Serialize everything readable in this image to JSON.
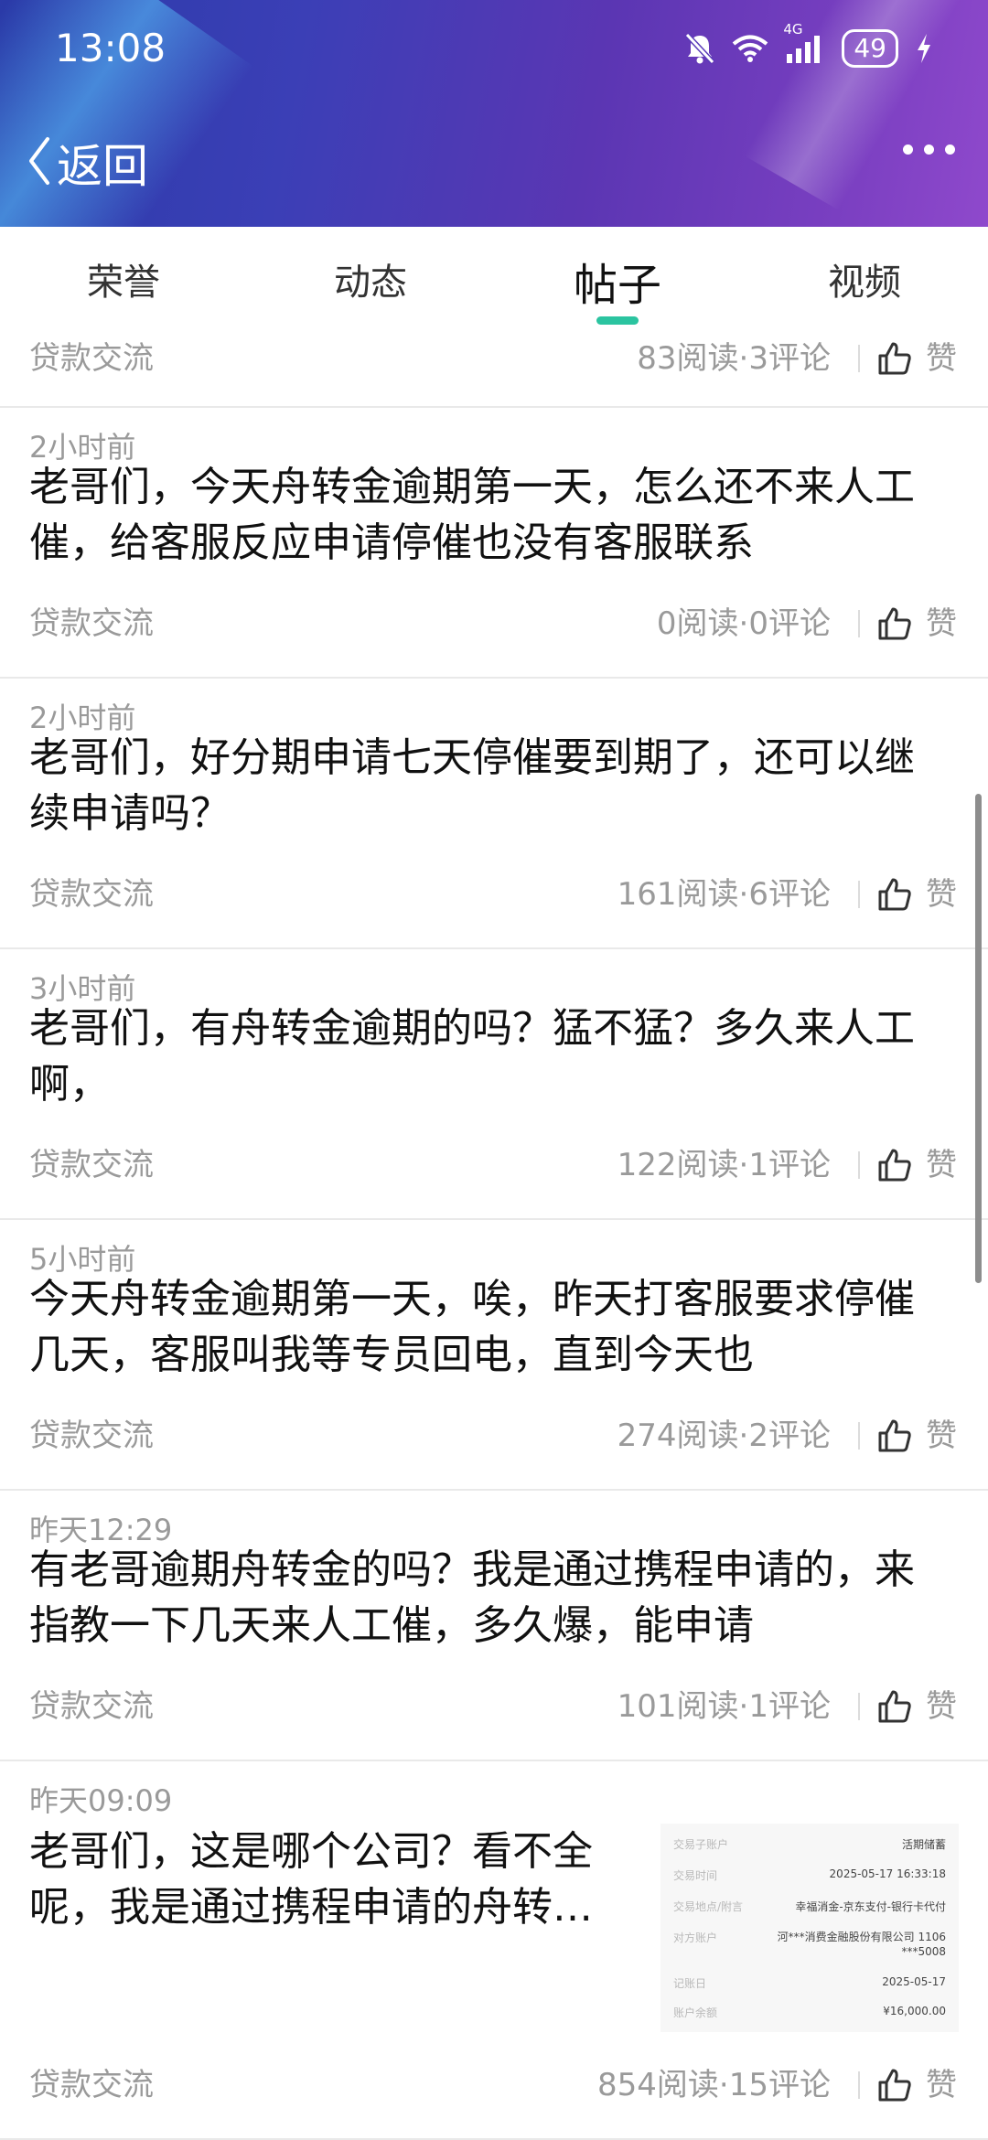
{
  "status_bar": {
    "time": "13:08",
    "network": "4G",
    "battery": "49",
    "icons": [
      "bell-muted-icon",
      "wifi-icon",
      "signal-icon",
      "battery-icon",
      "charging-icon"
    ]
  },
  "header": {
    "back_label": "返回",
    "more_icon": "more-dots-icon"
  },
  "tabs": [
    {
      "label": "荣誉",
      "active": false
    },
    {
      "label": "动态",
      "active": false
    },
    {
      "label": "帖子",
      "active": true
    },
    {
      "label": "视频",
      "active": false
    }
  ],
  "top_partial": {
    "category": "贷款交流",
    "stats": "83阅读·3评论",
    "like_label": "赞"
  },
  "posts": [
    {
      "time": "2小时前",
      "title": "老哥们，今天舟转金逾期第一天，怎么还不来人工催，给客服反应申请停催也没有客服联系",
      "category": "贷款交流",
      "stats": "0阅读·0评论",
      "like_label": "赞"
    },
    {
      "time": "2小时前",
      "title": "老哥们，好分期申请七天停催要到期了，还可以继续申请吗？",
      "category": "贷款交流",
      "stats": "161阅读·6评论",
      "like_label": "赞"
    },
    {
      "time": "3小时前",
      "title": "老哥们，有舟转金逾期的吗？猛不猛？多久来人工啊，",
      "category": "贷款交流",
      "stats": "122阅读·1评论",
      "like_label": "赞"
    },
    {
      "time": "5小时前",
      "title": "今天舟转金逾期第一天，唉，昨天打客服要求停催几天，客服叫我等专员回电，直到今天也",
      "category": "贷款交流",
      "stats": "274阅读·2评论",
      "like_label": "赞"
    },
    {
      "time": "昨天12:29",
      "title": "有老哥逾期舟转金的吗？我是通过携程申请的，来指教一下几天来人工催，多久爆，能申请",
      "category": "贷款交流",
      "stats": "101阅读·1评论",
      "like_label": "赞"
    },
    {
      "time": "昨天09:09",
      "title": "老哥们，这是哪个公司？看不全呢，我是通过携程申请的舟转…",
      "category": "贷款交流",
      "stats": "854阅读·15评论",
      "like_label": "赞",
      "thumbnail": {
        "rows": [
          {
            "k": "交易子账户",
            "v": "活期储蓄"
          },
          {
            "k": "交易时间",
            "v": "2025-05-17 16:33:18"
          },
          {
            "k": "交易地点/附言",
            "v": "幸福消金-京东支付-银行卡代付"
          },
          {
            "k": "对方账户",
            "v": "河***消费金融股份有限公司 1106***5008"
          },
          {
            "k": "记账日",
            "v": "2025-05-17"
          },
          {
            "k": "账户余额",
            "v": "¥16,000.00"
          }
        ]
      }
    }
  ]
}
